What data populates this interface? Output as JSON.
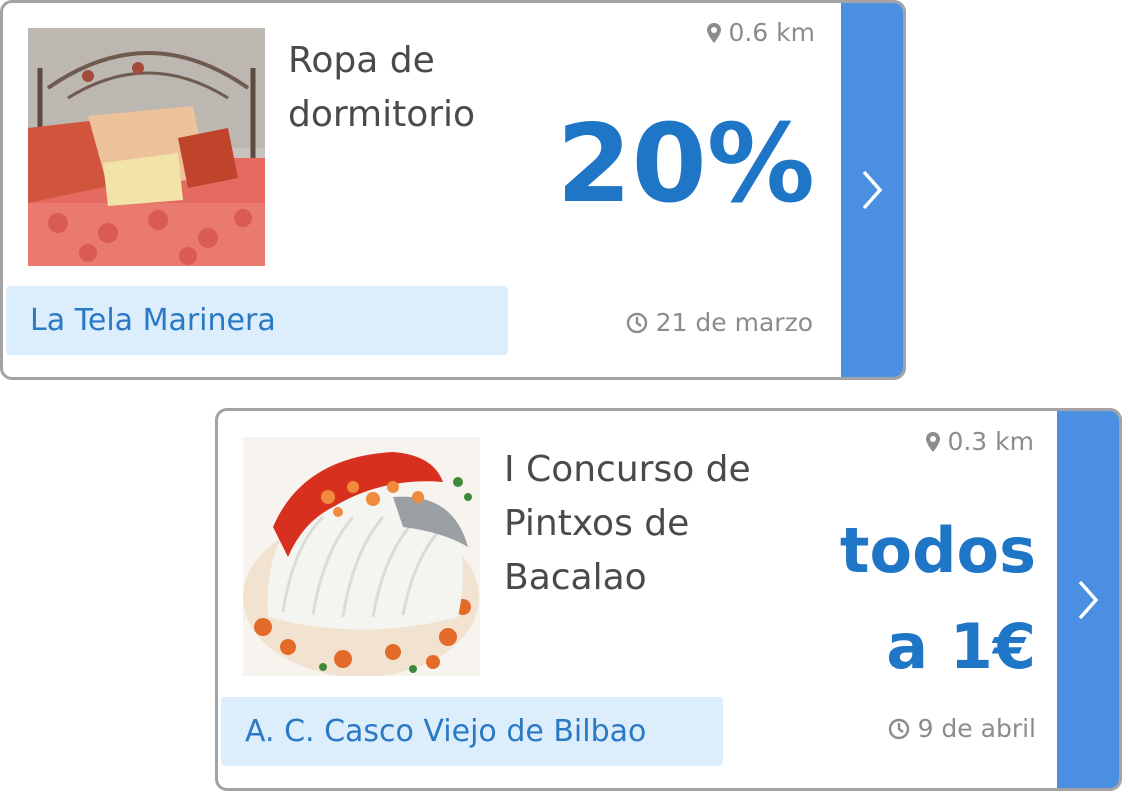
{
  "cards": [
    {
      "title": "Ropa de\ndormitorio",
      "distance": "0.6 km",
      "offer": "20%",
      "date": "21 de marzo",
      "merchant": "La Tela Marinera",
      "image": "bedding-photo",
      "icons": {
        "distance": "location-pin-icon",
        "date": "clock-icon",
        "action": "chevron-right-icon"
      }
    },
    {
      "title": "I Concurso de\nPintxos de\nBacalao",
      "distance": "0.3 km",
      "offer": "todos\na 1€",
      "date": "9 de abril",
      "merchant": "A. C. Casco Viejo de Bilbao",
      "image": "cod-dish-photo",
      "icons": {
        "distance": "location-pin-icon",
        "date": "clock-icon",
        "action": "chevron-right-icon"
      }
    }
  ],
  "colors": {
    "accent": "#1f75c6",
    "button": "#4a8fe2",
    "merchant_bg": "#dcedfc",
    "merchant_text": "#2a79c4",
    "muted_text": "#8c8c8c",
    "title_text": "#4a4a4a",
    "border": "#a3a3a3"
  }
}
